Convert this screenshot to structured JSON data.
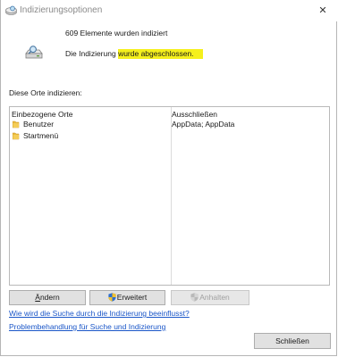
{
  "window": {
    "title": "Indizierungsoptionen",
    "close_glyph": "✕"
  },
  "status": {
    "count_text": "609 Elemente wurden indiziert",
    "message_prefix": "Die Indizierung ",
    "message_highlight": "wurde abgeschlossen.",
    "highlight_color": "#f5f01c"
  },
  "locations": {
    "section_label": "Diese Orte indizieren:",
    "columns": [
      "Einbezogene Orte",
      "Ausschließen"
    ],
    "rows": [
      {
        "name": "Benutzer",
        "exclude": "AppData; AppData"
      },
      {
        "name": "Startmenü",
        "exclude": ""
      }
    ]
  },
  "buttons": {
    "modify_prefix": "",
    "modify_access": "Ä",
    "modify_rest": "ndern",
    "advanced": "Erweitert",
    "pause": "Anhalten",
    "close": "Schließen"
  },
  "links": {
    "how_indexing": "Wie wird die Suche durch die Indizierung beeinflusst?",
    "troubleshoot": "Problembehandlung für Suche und Indizierung"
  },
  "icons": {
    "app": "indexing-options-icon",
    "status": "drive-search-icon",
    "folder": "folder-icon",
    "shield": "uac-shield-icon"
  }
}
